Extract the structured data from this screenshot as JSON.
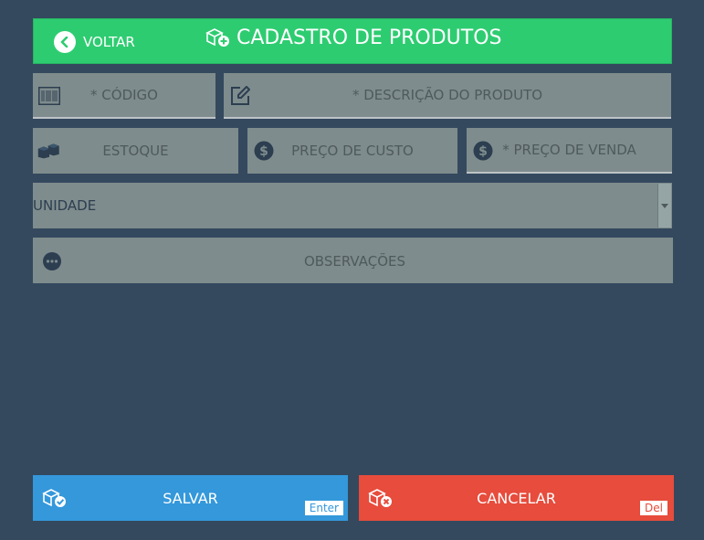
{
  "header": {
    "back_label": "VOLTAR",
    "title": "CADASTRO DE PRODUTOS"
  },
  "fields": {
    "codigo_placeholder": "* CÓDIGO",
    "descricao_placeholder": "* DESCRIÇÃO DO PRODUTO",
    "estoque_placeholder": "ESTOQUE",
    "preco_custo_placeholder": "PREÇO DE CUSTO",
    "preco_venda_placeholder": "* PREÇO DE VENDA",
    "unidade_selected": "UNIDADE",
    "observacoes_placeholder": "OBSERVAÇÕES"
  },
  "actions": {
    "save_label": "SALVAR",
    "save_key": "Enter",
    "cancel_label": "CANCELAR",
    "cancel_key": "Del"
  },
  "colors": {
    "background": "#34495e",
    "header": "#2ecc71",
    "field": "#7f8c8d",
    "save": "#3498db",
    "cancel": "#e74c3c"
  }
}
